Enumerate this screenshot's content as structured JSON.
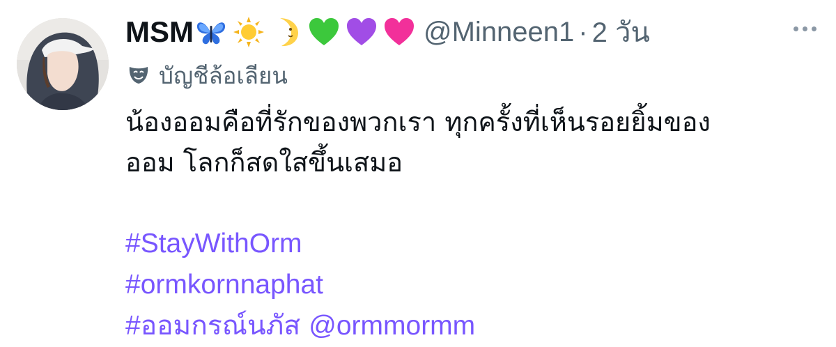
{
  "tweet": {
    "display_name": "MSM",
    "emojis": [
      "butterfly-emoji",
      "sun-emoji",
      "crescent-moon-face-emoji",
      "green-heart-emoji",
      "purple-heart-emoji",
      "pink-heart-emoji"
    ],
    "handle": "@Minneen1",
    "separator": "·",
    "time": "2 วัน",
    "account_label": "บัญชีล้อเลียน",
    "account_label_icon": "parody-masks-icon",
    "text_line_1": "น้องออมคือที่รักของพวกเรา ทุกครั้งที่เห็นรอยยิ้มของ",
    "text_line_2": "ออม โลกก็สดใสขึ้นเสมอ",
    "hashtag_1": "#StayWithOrm",
    "hashtag_2": "#ormkornnaphat",
    "hashtag_3": "#ออมกรณ์นภัส",
    "mention": "@ormmormm"
  },
  "colors": {
    "text": "#0f1419",
    "secondary": "#536471",
    "link": "#7856ff"
  }
}
